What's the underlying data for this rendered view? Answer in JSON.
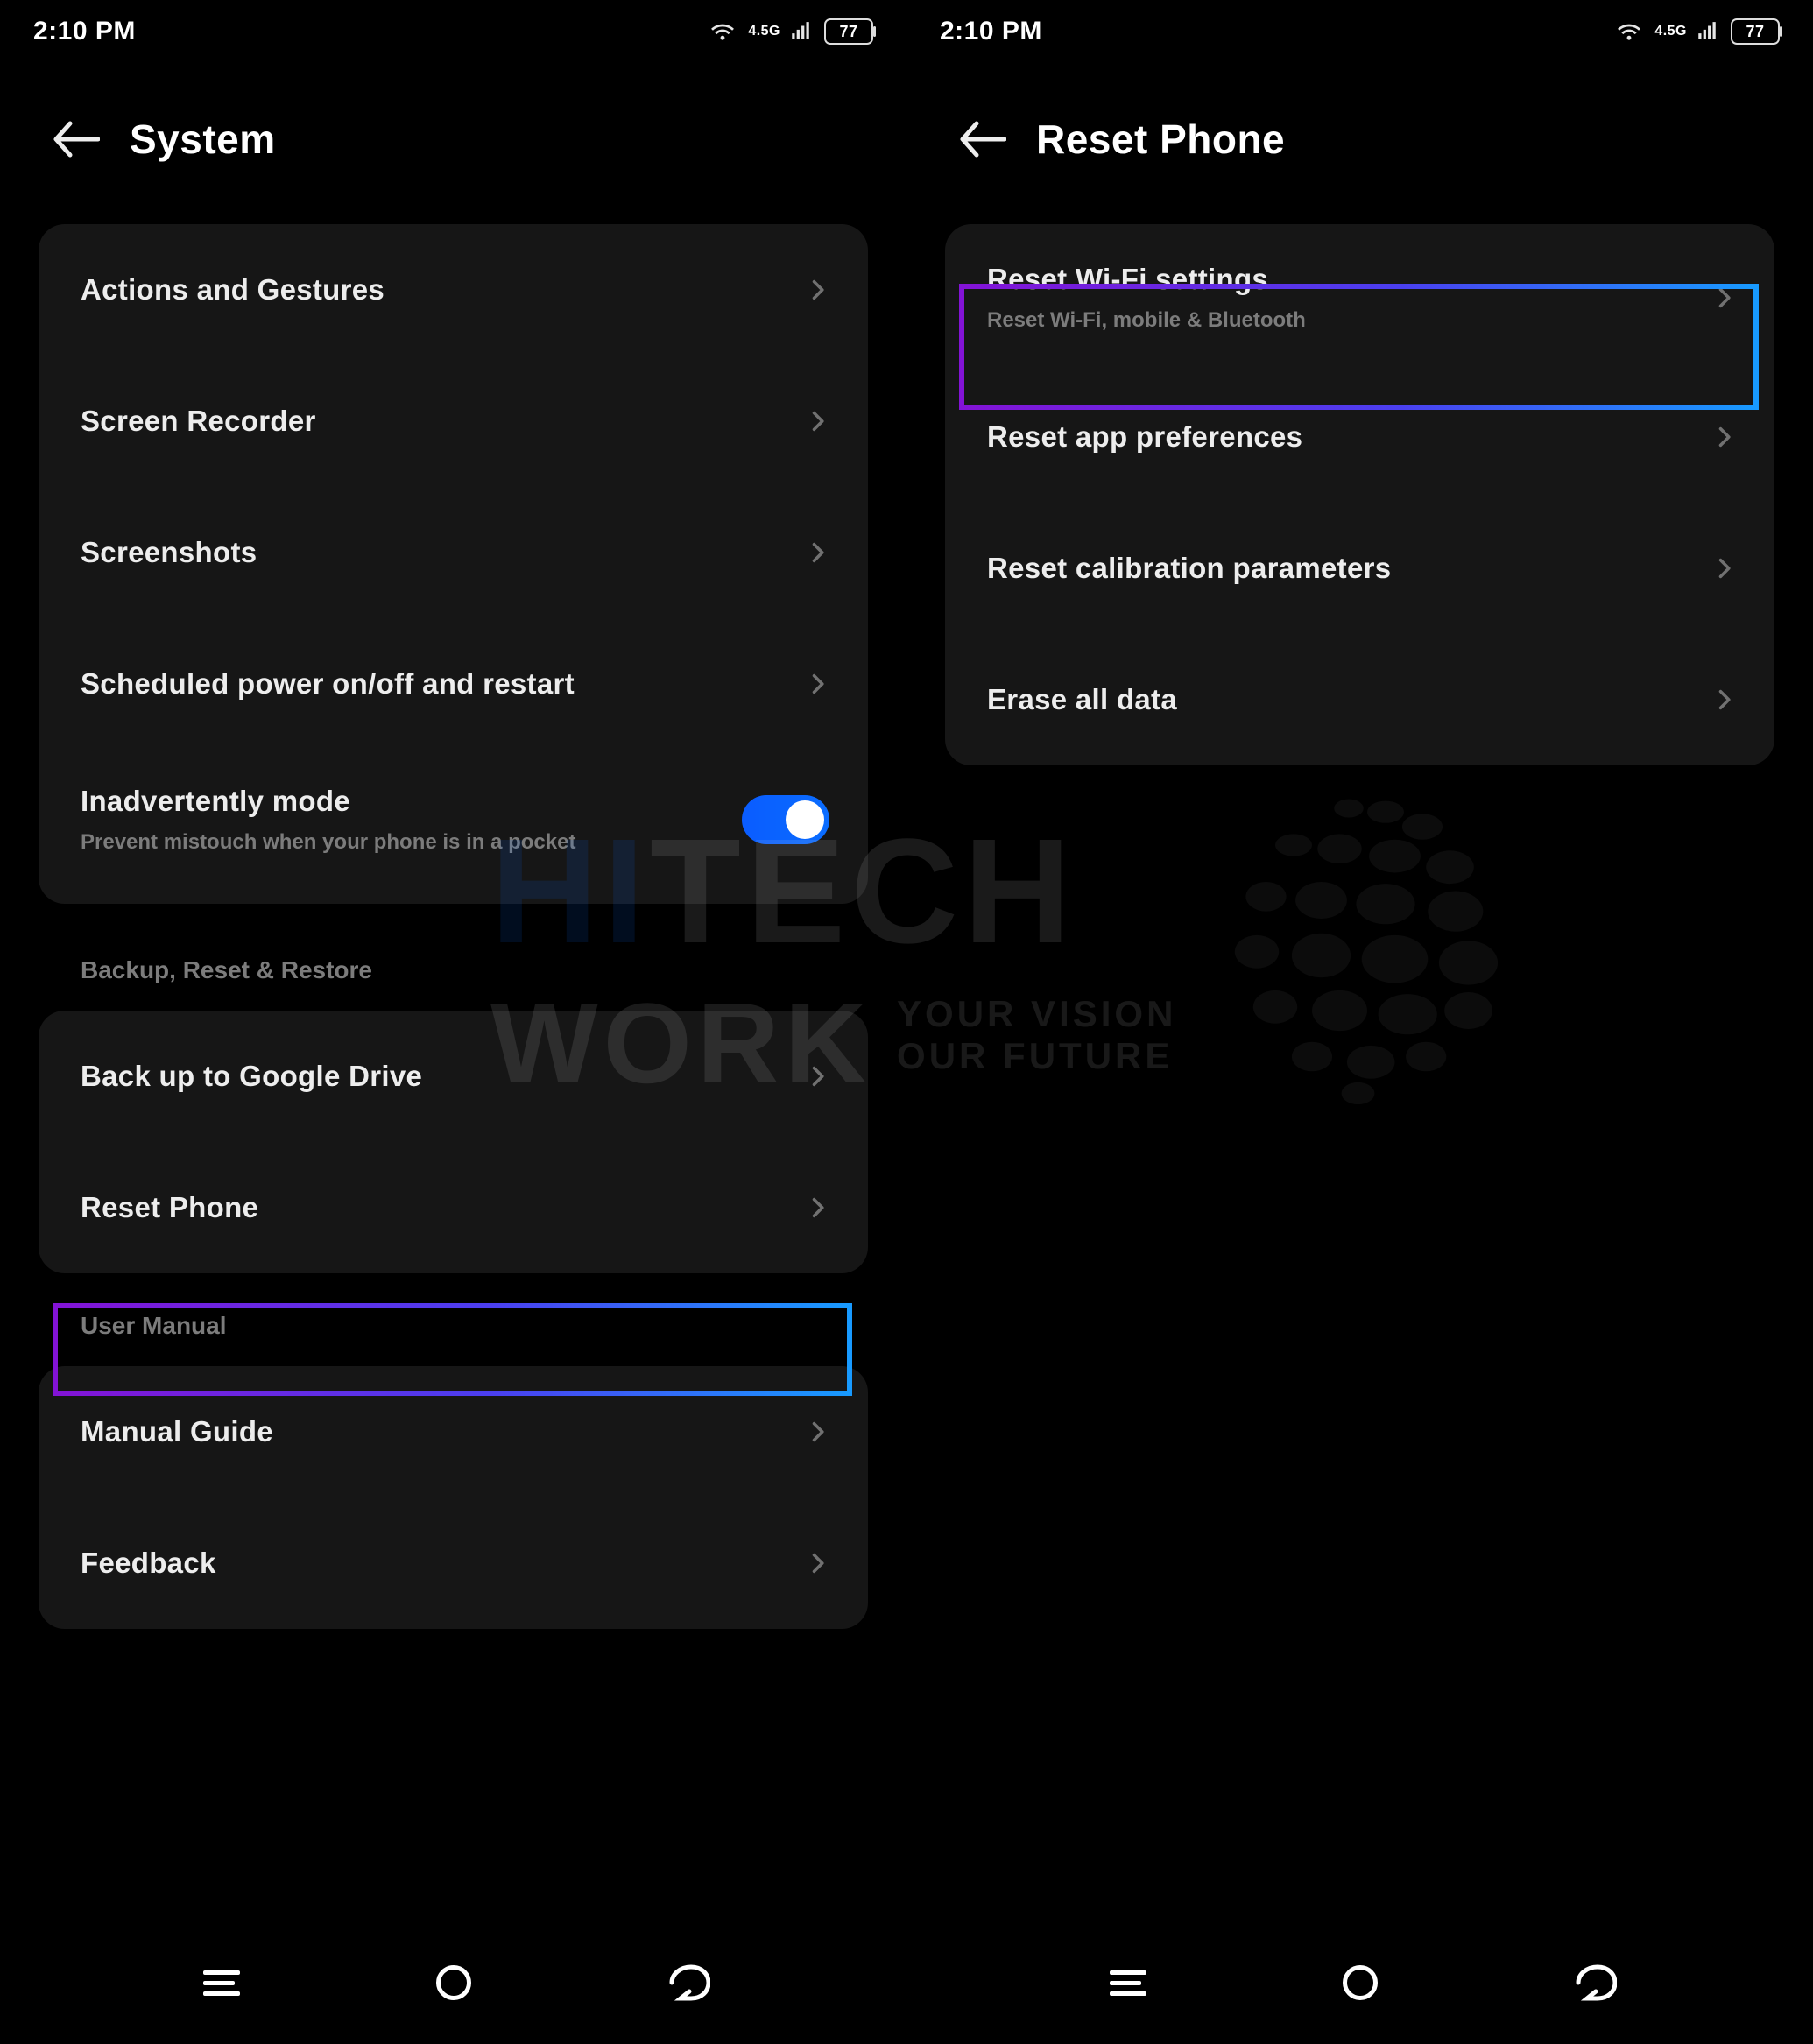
{
  "status": {
    "time": "2:10 PM",
    "network_badge": "4.5G",
    "battery_text": "77"
  },
  "left": {
    "page_title": "System",
    "group1": {
      "items": [
        {
          "title": "Actions and Gestures"
        },
        {
          "title": "Screen Recorder"
        },
        {
          "title": "Screenshots"
        },
        {
          "title": "Scheduled power on/off and restart"
        }
      ],
      "toggle_row": {
        "title": "Inadvertently mode",
        "subtitle": "Prevent mistouch when your phone is in a pocket",
        "value": true
      }
    },
    "section2_label": "Backup, Reset & Restore",
    "group2": {
      "items": [
        {
          "title": "Back up to Google Drive"
        },
        {
          "title": "Reset Phone"
        }
      ]
    },
    "section3_label": "User Manual",
    "group3": {
      "items": [
        {
          "title": "Manual Guide"
        },
        {
          "title": "Feedback"
        }
      ]
    }
  },
  "right": {
    "page_title": "Reset Phone",
    "group1": {
      "items": [
        {
          "title": "Reset Wi-Fi settings",
          "subtitle": "Reset Wi-Fi, mobile & Bluetooth"
        },
        {
          "title": "Reset app preferences"
        },
        {
          "title": "Reset calibration parameters"
        },
        {
          "title": "Erase all data"
        }
      ]
    }
  },
  "watermark": {
    "line1a": "HI",
    "line1b": "TECH",
    "line2": "WORK",
    "tag1": "YOUR VISION",
    "tag2": "OUR FUTURE"
  }
}
